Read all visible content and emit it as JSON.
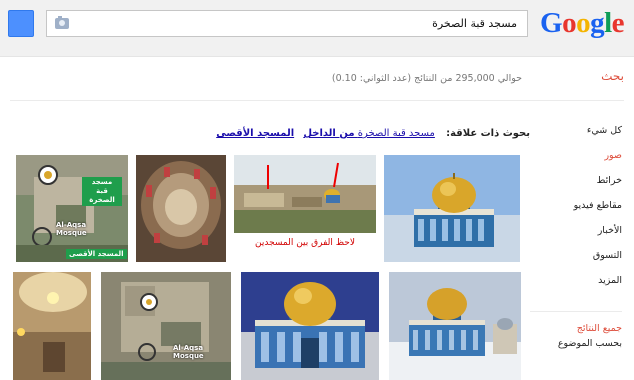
{
  "header": {
    "logo_letters": [
      "G",
      "o",
      "o",
      "g",
      "l",
      "e"
    ],
    "logo_colors": [
      "#1a62f0",
      "#e8362e",
      "#f4b400",
      "#1a62f0",
      "#0f9d58",
      "#e8362e"
    ],
    "search_value": "مسجد قبة الصخرة"
  },
  "results": {
    "search_label": "بحث",
    "stats": "حوالي 295,000 من النتائج (عدد الثواني: 0.10)"
  },
  "nav": {
    "items": [
      "كل شيء",
      "صور",
      "خرائط",
      "مقاطع فيديو",
      "الأخبار",
      "التسوق",
      "المزيد"
    ],
    "active_index": 1,
    "all_results": "جميع النتائج",
    "by_subject": "بحسب الموضوع"
  },
  "related": {
    "label": "بحوث ذات علاقة:",
    "link1": "مسجد قبة الصخرة",
    "link1_bold": "من الداخل",
    "link2": "المسجد الأقصى"
  },
  "images": {
    "caption_diff": "لاحظ الفرق بين المسجدين",
    "map_tag_1": "مسجد قبة الصخرة",
    "map_label_aqsa": "Al-Aqsa Mosque",
    "map_tag_aqsa": "المسجد الأقصى",
    "map2_label": "Al-Aqsa Mosque"
  }
}
